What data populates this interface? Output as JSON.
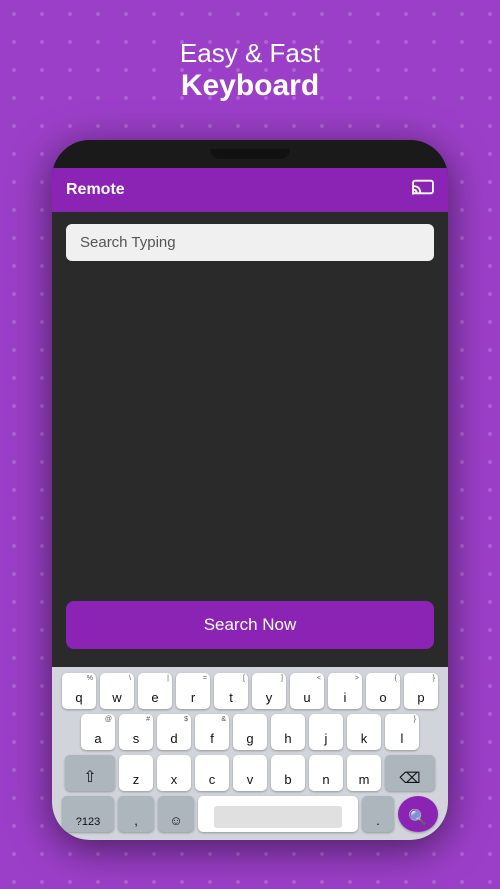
{
  "header": {
    "line1": "Easy & Fast",
    "line2": "Keyboard"
  },
  "appbar": {
    "title": "Remote",
    "cast_icon": "⬛"
  },
  "search": {
    "placeholder": "Search Typing"
  },
  "buttons": {
    "search_now": "Search Now"
  },
  "keyboard": {
    "row1": [
      {
        "super": "%",
        "main": "q"
      },
      {
        "super": "\\",
        "main": "w"
      },
      {
        "super": "|",
        "main": "e"
      },
      {
        "super": "=",
        "main": "r"
      },
      {
        "super": "[",
        "main": "t"
      },
      {
        "super": "]",
        "main": "y"
      },
      {
        "super": "<",
        "main": "u"
      },
      {
        "super": ">",
        "main": "i"
      },
      {
        "super": "{",
        "main": "o"
      },
      {
        "super": "",
        "main": "p"
      }
    ],
    "row2": [
      {
        "super": "@",
        "main": "a"
      },
      {
        "super": "#",
        "main": "s"
      },
      {
        "super": "$",
        "main": "d"
      },
      {
        "super": "&",
        "main": "f"
      },
      {
        "super": "",
        "main": "g"
      },
      {
        "super": "",
        "main": "h"
      },
      {
        "super": "",
        "main": "j"
      },
      {
        "super": "",
        "main": "k"
      },
      {
        "super": "}",
        "main": "l"
      }
    ],
    "row3_left": "⇧",
    "row3": [
      {
        "super": "",
        "main": "z"
      },
      {
        "super": "",
        "main": "x"
      },
      {
        "super": "",
        "main": "c"
      },
      {
        "super": "",
        "main": "v"
      },
      {
        "super": "",
        "main": "b"
      },
      {
        "super": "",
        "main": "n"
      },
      {
        "super": "",
        "main": "m"
      }
    ],
    "row3_right": "⌫",
    "row4_123": "?123",
    "row4_emoji": "☺",
    "row4_period": ".",
    "row4_search": "🔍"
  }
}
